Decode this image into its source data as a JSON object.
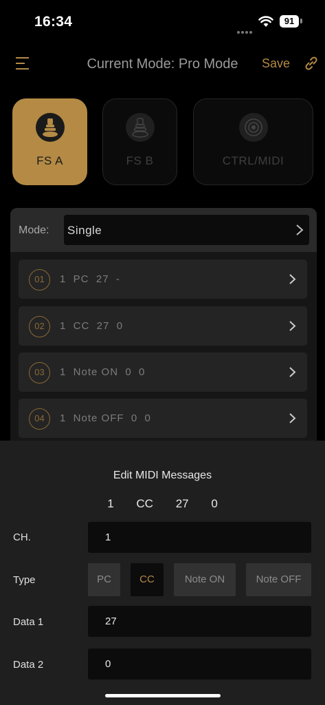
{
  "status_bar": {
    "time": "16:34",
    "battery": "91"
  },
  "header": {
    "title": "Current Mode: Pro Mode",
    "save_label": "Save"
  },
  "tabs": [
    {
      "label": "FS A",
      "active": true
    },
    {
      "label": "FS B",
      "active": false
    },
    {
      "label": "CTRL/MIDI",
      "active": false
    }
  ],
  "mode": {
    "label": "Mode:",
    "value": "Single"
  },
  "messages": [
    {
      "num": "01",
      "text": "1  PC  27  -"
    },
    {
      "num": "02",
      "text": "1  CC  27  0"
    },
    {
      "num": "03",
      "text": "1  Note ON  0  0"
    },
    {
      "num": "04",
      "text": "1  Note OFF  0  0"
    }
  ],
  "sheet": {
    "title": "Edit MIDI Messages",
    "summary": [
      "1",
      "CC",
      "27",
      "0"
    ],
    "ch": {
      "label": "CH.",
      "value": "1"
    },
    "type": {
      "label": "Type",
      "options": [
        "PC",
        "CC",
        "Note ON",
        "Note OFF"
      ],
      "selected": "CC"
    },
    "data1": {
      "label": "Data 1",
      "value": "27"
    },
    "data2": {
      "label": "Data 2",
      "value": "0"
    }
  },
  "colors": {
    "accent": "#b48a45",
    "background": "#000000",
    "sheet": "#1f1f1f"
  }
}
